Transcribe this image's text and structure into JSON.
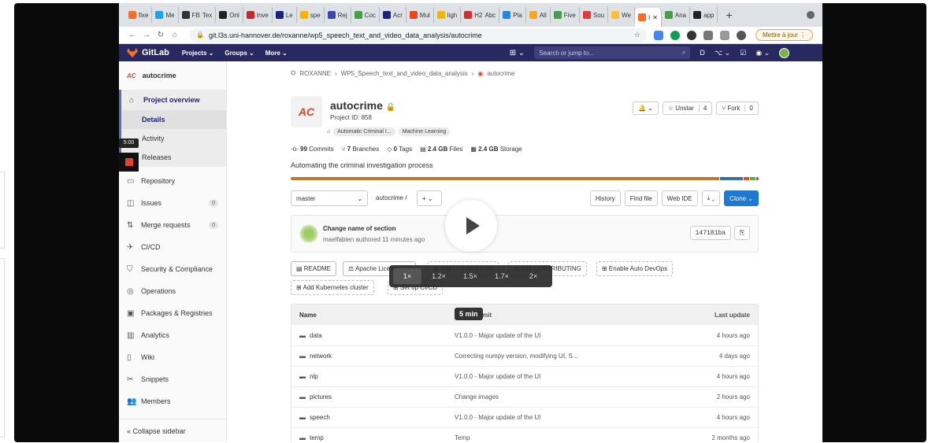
{
  "browser": {
    "tabs": [
      {
        "label": "fixe",
        "color": "#fc6d26"
      },
      {
        "label": "Me",
        "color": "#1da1f2"
      },
      {
        "label": "Tex",
        "color": "#333333",
        "prefix": "FB"
      },
      {
        "label": "Onl",
        "color": "#222222"
      },
      {
        "label": "Inve",
        "color": "#c62828"
      },
      {
        "label": "Le",
        "color": "#1a237e"
      },
      {
        "label": "spe",
        "color": "#f4b400"
      },
      {
        "label": "Rej",
        "color": "#3949ab"
      },
      {
        "label": "Coc",
        "color": "#43a047"
      },
      {
        "label": "Acr",
        "color": "#1a237e"
      },
      {
        "label": "Mul",
        "color": "#e64a19"
      },
      {
        "label": "ligh",
        "color": "#f4b400"
      },
      {
        "label": "Abc",
        "color": "#d32f2f",
        "prefix": "H2"
      },
      {
        "label": "Pla",
        "color": "#1e88e5"
      },
      {
        "label": "All",
        "color": "#f9a825"
      },
      {
        "label": "Five",
        "color": "#43a047"
      },
      {
        "label": "Sou",
        "color": "#e53935"
      },
      {
        "label": "We",
        "color": "#fbc02d"
      },
      {
        "label": "I",
        "color": "#fc6d26",
        "active": true
      },
      {
        "label": "Ana",
        "color": "#43a047"
      },
      {
        "label": "app",
        "color": "#222222"
      }
    ],
    "close_glyph": "✕",
    "new_tab_glyph": "+",
    "url": "git.l3s.uni-hannover.de/roxanne/wp5_speech_text_and_video_data_analysis/autocrime",
    "update_button": "Mettre à jour",
    "update_glyph": "⋮"
  },
  "gitlab_header": {
    "brand": "GitLab",
    "menus": [
      "Projects ⌄",
      "Groups ⌄",
      "More ⌄"
    ],
    "plus": "⊞ ⌄",
    "search_placeholder": "Search or jump to...",
    "search_glyph": "⌕",
    "icons": [
      "D",
      "⌥ ⌄",
      "☑",
      "◉ ⌄"
    ]
  },
  "sidebar": {
    "project_initials": "AC",
    "project_name": "autocrime",
    "overview": "Project overview",
    "sub_items": [
      "Details",
      "Activity",
      "Releases"
    ],
    "items": [
      {
        "icon": "▭",
        "label": "Repository",
        "count": ""
      },
      {
        "icon": "◫",
        "label": "Issues",
        "count": "0"
      },
      {
        "icon": "⇅",
        "label": "Merge requests",
        "count": "0"
      },
      {
        "icon": "✈",
        "label": "CI/CD",
        "count": ""
      },
      {
        "icon": "⛉",
        "label": "Security & Compliance",
        "count": ""
      },
      {
        "icon": "◎",
        "label": "Operations",
        "count": ""
      },
      {
        "icon": "▣",
        "label": "Packages & Registries",
        "count": ""
      },
      {
        "icon": "▥",
        "label": "Analytics",
        "count": ""
      },
      {
        "icon": "▯",
        "label": "Wiki",
        "count": ""
      },
      {
        "icon": "✂",
        "label": "Snippets",
        "count": ""
      },
      {
        "icon": "👥",
        "label": "Members",
        "count": ""
      }
    ],
    "collapse": "« Collapse sidebar"
  },
  "recording": {
    "timer": "5:00"
  },
  "breadcrumb": [
    "ROXANNE",
    "WP5_Speech_text_and_video_data_analysis",
    "autocrime"
  ],
  "breadcrumb_sep": "›",
  "project": {
    "initials": "AC",
    "title": "autocrime",
    "lock_glyph": "🔒",
    "id_text": "Project ID: 858",
    "topics": [
      "Automatic Criminal I...",
      "Machine Learning"
    ],
    "topic_glyph": "⌂",
    "notify_glyph": "🔔 ⌄",
    "unstar": "☆ Unstar",
    "star_count": "4",
    "fork": "⑂ Fork",
    "fork_count": "0",
    "stats": [
      {
        "num": "99",
        "label": "Commits",
        "icon": "-o-"
      },
      {
        "num": "7",
        "label": "Branches",
        "icon": "⑂"
      },
      {
        "num": "0",
        "label": "Tags",
        "icon": "◇"
      },
      {
        "num": "2.4 GB",
        "label": "Files",
        "icon": "▤"
      },
      {
        "num": "2.4 GB",
        "label": "Storage",
        "icon": "▦"
      }
    ],
    "description": "Automating the criminal investigation process",
    "language_colors": [
      "#c0792c",
      "#3572a5",
      "#e34c26",
      "#4caf50",
      "#d73a49"
    ],
    "language_shares": [
      0.915,
      0.05,
      0.012,
      0.012,
      0.011
    ]
  },
  "repo_toolbar": {
    "branch": "master",
    "branch_caret": "⌄",
    "path": "autocrime  /",
    "add_button": "+ ⌄",
    "buttons": [
      "History",
      "Find file",
      "Web IDE",
      "⤓ ⌄"
    ],
    "clone": "Clone ⌄"
  },
  "last_commit": {
    "title": "Change name of section",
    "meta": "maelfabien authored 11 minutes ago",
    "sha": "147181ba",
    "copy_glyph": "⎘"
  },
  "quick_links": [
    "▤ README",
    "⚖ Apache License 2.0",
    "⊞ Add CHANGELOG",
    "⊞ Add CONTRIBUTING",
    "⊞ Enable Auto DevOps",
    "⊞ Add Kubernetes cluster",
    "⊞ Set up CI/CD"
  ],
  "file_table": {
    "headers": [
      "Name",
      "Last commit",
      "Last update"
    ],
    "folder_glyph": "▬",
    "rows": [
      {
        "name": "data",
        "commit": "V1.0.0 - Major update of the UI",
        "updated": "4 hours ago"
      },
      {
        "name": "network",
        "commit": "Correcting numpy version, modifying UI, S...",
        "updated": "4 days ago"
      },
      {
        "name": "nlp",
        "commit": "V1.0.0 - Major update of the UI",
        "updated": "4 hours ago"
      },
      {
        "name": "pictures",
        "commit": "Change images",
        "updated": "2 hours ago"
      },
      {
        "name": "speech",
        "commit": "V1.0.0 - Major update of the UI",
        "updated": "4 hours ago"
      },
      {
        "name": "temp",
        "commit": "Temp",
        "updated": "2 months ago"
      }
    ]
  },
  "video_overlay": {
    "speeds": [
      "1×",
      "1.2×",
      "1.5×",
      "1.7×",
      "2×"
    ],
    "active_speed": "1×",
    "duration": "5 min"
  }
}
